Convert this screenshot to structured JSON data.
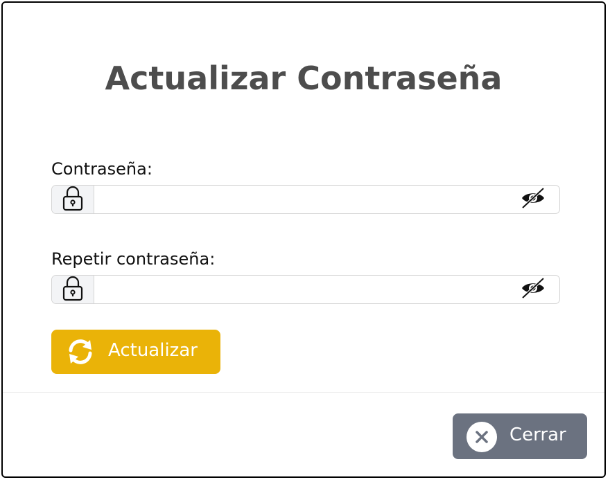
{
  "dialog": {
    "title": "Actualizar Contraseña"
  },
  "form": {
    "password": {
      "label": "Contraseña:",
      "value": "",
      "prefix_icon": "lock-icon",
      "toggle_icon": "eye-slash-icon"
    },
    "repeat_password": {
      "label": "Repetir contraseña:",
      "value": "",
      "prefix_icon": "lock-icon",
      "toggle_icon": "eye-slash-icon"
    },
    "submit": {
      "label": "Actualizar",
      "icon": "refresh-icon",
      "color": "#eab308"
    }
  },
  "footer": {
    "close": {
      "label": "Cerrar",
      "icon": "close-icon",
      "color": "#6b7280"
    }
  }
}
